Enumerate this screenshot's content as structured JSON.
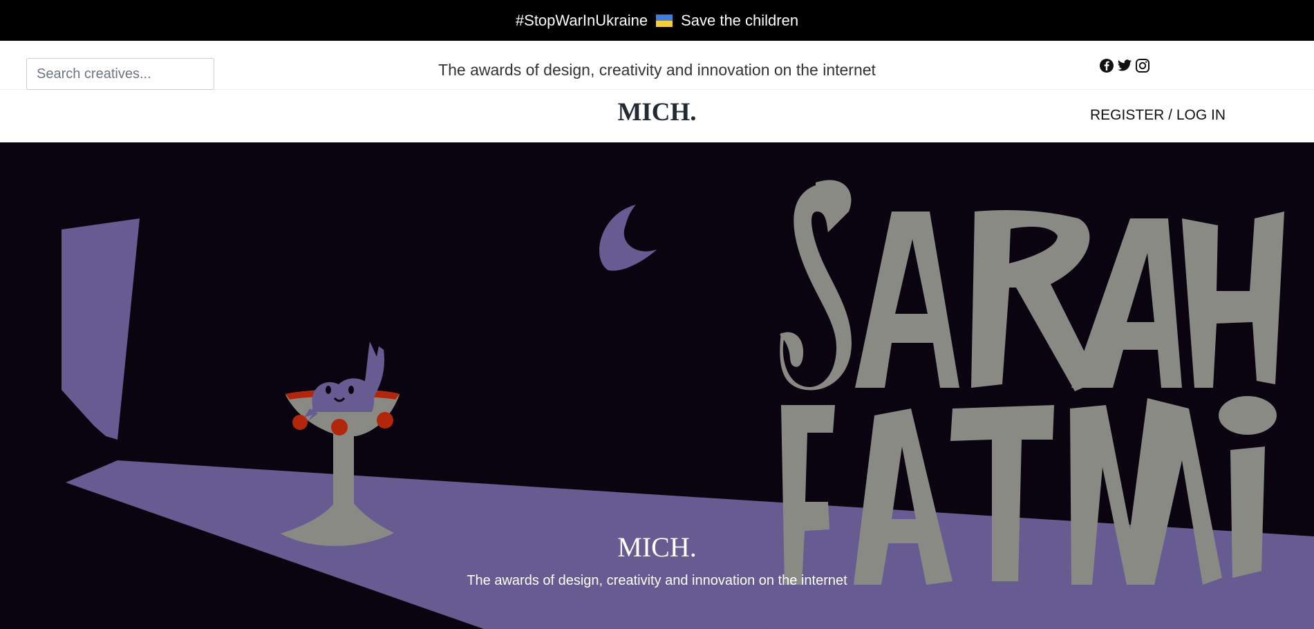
{
  "announcement": {
    "hashtag": "#StopWarInUkraine",
    "flag_icon": "ukraine-flag-icon",
    "link_label": "Save the children"
  },
  "search": {
    "placeholder": "Search creatives..."
  },
  "header": {
    "tagline": "The awards of design, creativity and innovation on the internet",
    "social_icons": [
      "facebook-icon",
      "twitter-icon",
      "instagram-icon"
    ]
  },
  "nav": {
    "logo": "MICH.",
    "register_login": "REGISTER / LOG IN"
  },
  "hero": {
    "title": "MICH.",
    "subtitle": "The awards of design, creativity and innovation on the internet",
    "artwork_text": "SARAH FATMI",
    "colors": {
      "background": "#090410",
      "purple": "#675c92",
      "grey": "#8a8a85",
      "red": "#b2260c"
    }
  }
}
